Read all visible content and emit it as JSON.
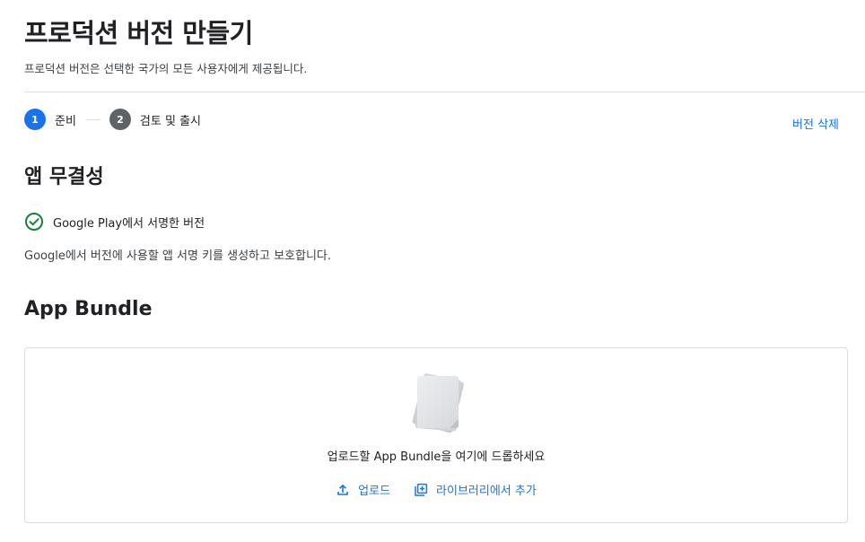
{
  "header": {
    "title": "프로덕션 버전 만들기",
    "subtitle": "프로덕션 버전은 선택한 국가의 모든 사용자에게 제공됩니다."
  },
  "stepper": {
    "steps": [
      {
        "number": "1",
        "label": "준비",
        "state": "active"
      },
      {
        "number": "2",
        "label": "검토 및 출시",
        "state": "inactive"
      }
    ],
    "delete_label": "버전 삭제"
  },
  "integrity": {
    "heading": "앱 무결성",
    "status_icon": "check-circle-icon",
    "status_text": "Google Play에서 서명한 버전",
    "description": "Google에서 버전에 사용할 앱 서명 키를 생성하고 보호합니다."
  },
  "bundle": {
    "heading": "App Bundle",
    "illustration_icon": "document-stack-icon",
    "drop_text": "업로드할 App Bundle을 여기에 드롭하세요",
    "upload_label": "업로드",
    "upload_icon": "upload-icon",
    "library_label": "라이브러리에서 추가",
    "library_icon": "library-add-icon"
  },
  "colors": {
    "accent": "#1a73e8",
    "success": "#188038",
    "inactive_step": "#5f6368",
    "border": "#dadce0"
  }
}
